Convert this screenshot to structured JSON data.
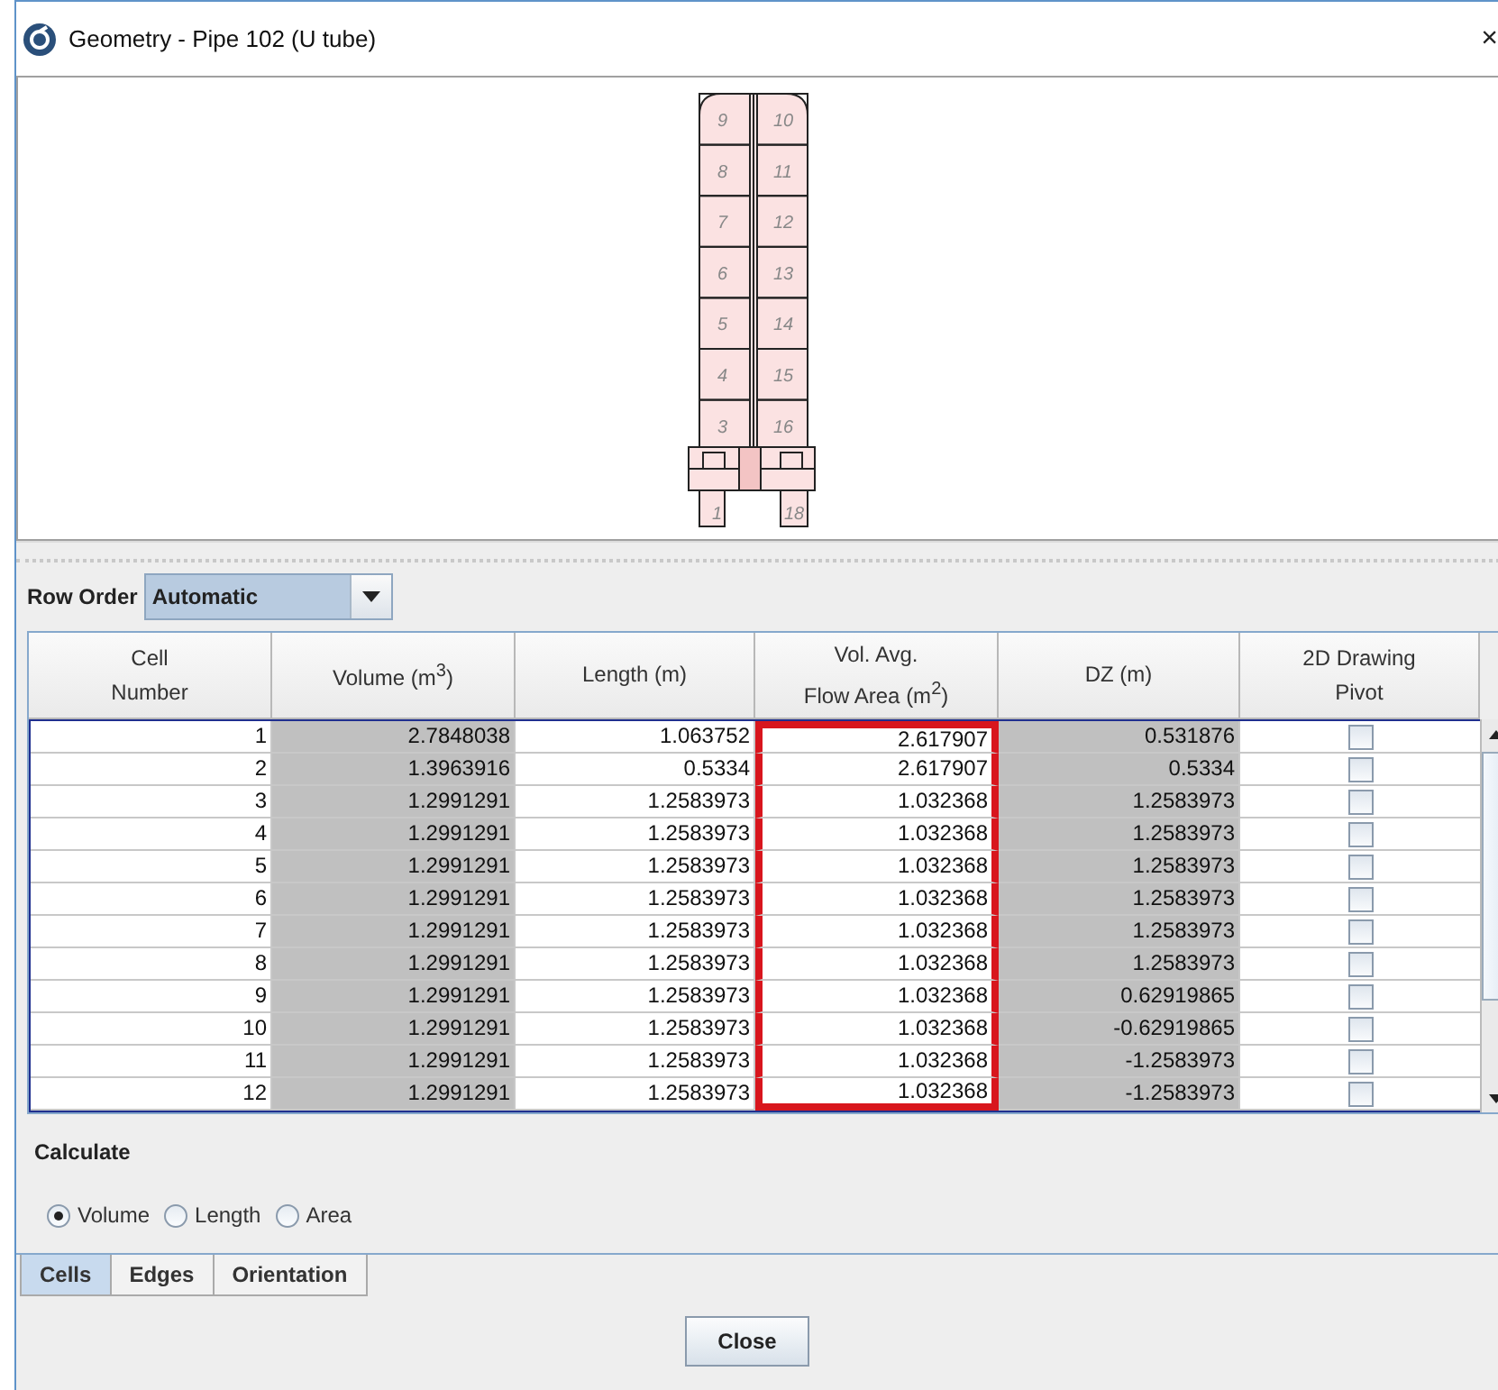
{
  "window": {
    "title": "Geometry - Pipe 102 (U tube)",
    "close": "×"
  },
  "diagram": {
    "left_cells": [
      "9",
      "8",
      "7",
      "6",
      "5",
      "4",
      "3"
    ],
    "right_cells": [
      "10",
      "11",
      "12",
      "13",
      "14",
      "15",
      "16"
    ],
    "bottom_cells": [
      "1",
      "18"
    ]
  },
  "row_order": {
    "label": "Row Order",
    "value": "Automatic"
  },
  "table": {
    "columns": [
      {
        "lines": [
          "Cell",
          "Number"
        ],
        "kind": "text",
        "shaded": false,
        "highlighted": false
      },
      {
        "lines": [
          "Volume (m$^{3}$)"
        ],
        "kind": "text",
        "shaded": true,
        "highlighted": false
      },
      {
        "lines": [
          "Length (m)"
        ],
        "kind": "text",
        "shaded": false,
        "highlighted": false
      },
      {
        "lines": [
          "Vol. Avg.",
          "Flow Area (m$^{2}$)"
        ],
        "kind": "text",
        "shaded": false,
        "highlighted": true
      },
      {
        "lines": [
          "DZ (m)"
        ],
        "kind": "text",
        "shaded": true,
        "highlighted": false
      },
      {
        "lines": [
          "2D Drawing",
          "Pivot"
        ],
        "kind": "checkbox",
        "shaded": false,
        "highlighted": false
      }
    ],
    "rows": [
      {
        "cells": [
          "1",
          "2.7848038",
          "1.063752",
          "2.617907",
          "0.531876"
        ],
        "pivot": false
      },
      {
        "cells": [
          "2",
          "1.3963916",
          "0.5334",
          "2.617907",
          "0.5334"
        ],
        "pivot": false
      },
      {
        "cells": [
          "3",
          "1.2991291",
          "1.2583973",
          "1.032368",
          "1.2583973"
        ],
        "pivot": false
      },
      {
        "cells": [
          "4",
          "1.2991291",
          "1.2583973",
          "1.032368",
          "1.2583973"
        ],
        "pivot": false
      },
      {
        "cells": [
          "5",
          "1.2991291",
          "1.2583973",
          "1.032368",
          "1.2583973"
        ],
        "pivot": false
      },
      {
        "cells": [
          "6",
          "1.2991291",
          "1.2583973",
          "1.032368",
          "1.2583973"
        ],
        "pivot": false
      },
      {
        "cells": [
          "7",
          "1.2991291",
          "1.2583973",
          "1.032368",
          "1.2583973"
        ],
        "pivot": false
      },
      {
        "cells": [
          "8",
          "1.2991291",
          "1.2583973",
          "1.032368",
          "1.2583973"
        ],
        "pivot": false
      },
      {
        "cells": [
          "9",
          "1.2991291",
          "1.2583973",
          "1.032368",
          "0.62919865"
        ],
        "pivot": false
      },
      {
        "cells": [
          "10",
          "1.2991291",
          "1.2583973",
          "1.032368",
          "-0.62919865"
        ],
        "pivot": false
      },
      {
        "cells": [
          "11",
          "1.2991291",
          "1.2583973",
          "1.032368",
          "-1.2583973"
        ],
        "pivot": false
      },
      {
        "cells": [
          "12",
          "1.2991291",
          "1.2583973",
          "1.032368",
          "-1.2583973"
        ],
        "pivot": false
      }
    ]
  },
  "calculate": {
    "label": "Calculate",
    "options": [
      {
        "label": "Volume",
        "selected": true
      },
      {
        "label": "Length",
        "selected": false
      },
      {
        "label": "Area",
        "selected": false
      }
    ]
  },
  "tabs": [
    {
      "label": "Cells",
      "selected": true
    },
    {
      "label": "Edges",
      "selected": false
    },
    {
      "label": "Orientation",
      "selected": false
    }
  ],
  "buttons": [
    "Close"
  ]
}
